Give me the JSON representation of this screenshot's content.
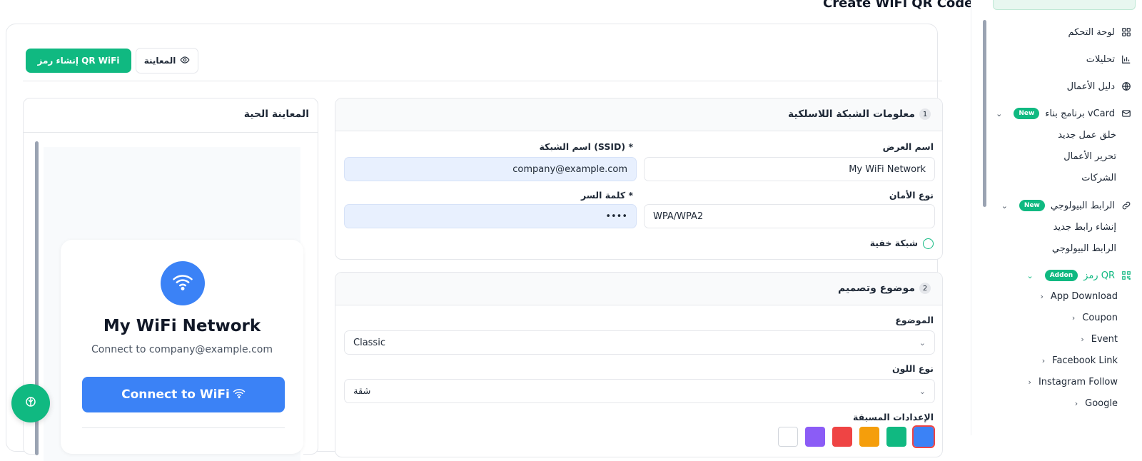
{
  "page": {
    "title": "Create WiFi QR Code"
  },
  "toolbar": {
    "create_label": "إنشاء رمز QR WiFi",
    "preview_label": "المعاينة"
  },
  "preview": {
    "title": "المعاينة الحية",
    "network_name": "My WiFi Network",
    "connect_text": "Connect to company@example.com",
    "button_label": "Connect to WiFi"
  },
  "network_info": {
    "step": "1",
    "title": "معلومات الشبكة اللاسلكية",
    "display_name_label": "اسم العرض",
    "display_name_value": "My WiFi Network",
    "ssid_label": "اسم الشبكة (SSID) *",
    "ssid_value": "company@example.com",
    "security_label": "نوع الأمان",
    "security_value": "WPA/WPA2",
    "password_label": "كلمة السر *",
    "password_value": "••••",
    "hidden_label": "شبكة خفية"
  },
  "theme": {
    "step": "2",
    "title": "موضوع وتصميم",
    "theme_label": "الموضوع",
    "theme_value": "Classic",
    "color_type_label": "نوع اللون",
    "color_type_value": "شقة",
    "presets_label": "الإعدادات المسبقة",
    "preset_colors": [
      "#3b82f6",
      "#10b981",
      "#f59e0b",
      "#ef4444",
      "#8b5cf6"
    ]
  },
  "sidebar": {
    "items": [
      {
        "label": "لوحة التحكم",
        "icon": "grid-icon"
      },
      {
        "label": "تحليلات",
        "icon": "bar-chart-icon"
      },
      {
        "label": "دليل الأعمال",
        "icon": "globe-icon"
      },
      {
        "label": "برنامج بناء vCard",
        "icon": "mail-icon",
        "badge": "New"
      },
      {
        "label": "الرابط البيولوجي",
        "icon": "link-icon",
        "badge": "New"
      },
      {
        "label": "رمز QR",
        "icon": "qr-icon",
        "badge": "Addon"
      }
    ],
    "vcard_sub": [
      "خلق عمل جديد",
      "تحرير الأعمال",
      "الشركات"
    ],
    "bio_sub": [
      "إنشاء رابط جديد",
      "الرابط البيولوجي"
    ],
    "qr_sub": [
      "App Download",
      "Coupon",
      "Event",
      "Facebook Link",
      "Instagram Follow",
      "Google"
    ]
  },
  "colors": {
    "accent": "#10b981",
    "brand_blue": "#3b82f6"
  }
}
